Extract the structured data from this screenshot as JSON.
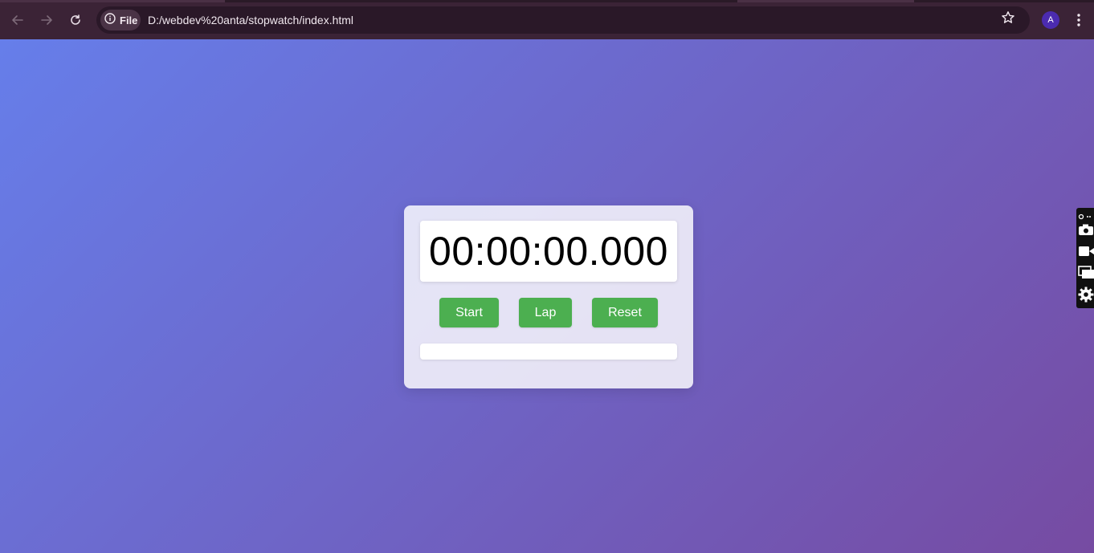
{
  "browser": {
    "file_chip_label": "File",
    "url": "D:/webdev%20anta/stopwatch/index.html",
    "profile_initial": "A",
    "icons": [
      "back-arrow-icon",
      "forward-arrow-icon",
      "reload-icon",
      "info-icon",
      "star-icon",
      "kebab-menu-icon"
    ]
  },
  "stopwatch": {
    "time": "00:00:00.000",
    "buttons": {
      "start": "Start",
      "lap": "Lap",
      "reset": "Reset"
    },
    "laps": []
  },
  "side_toolbar": {
    "icons": [
      "link-icon",
      "camera-icon",
      "video-icon",
      "window-icon",
      "gear-icon"
    ]
  },
  "colors": {
    "gradient_start": "#667eea",
    "gradient_end": "#764ba2",
    "button_green": "#4caf50",
    "chrome_bg": "#3b2336"
  }
}
